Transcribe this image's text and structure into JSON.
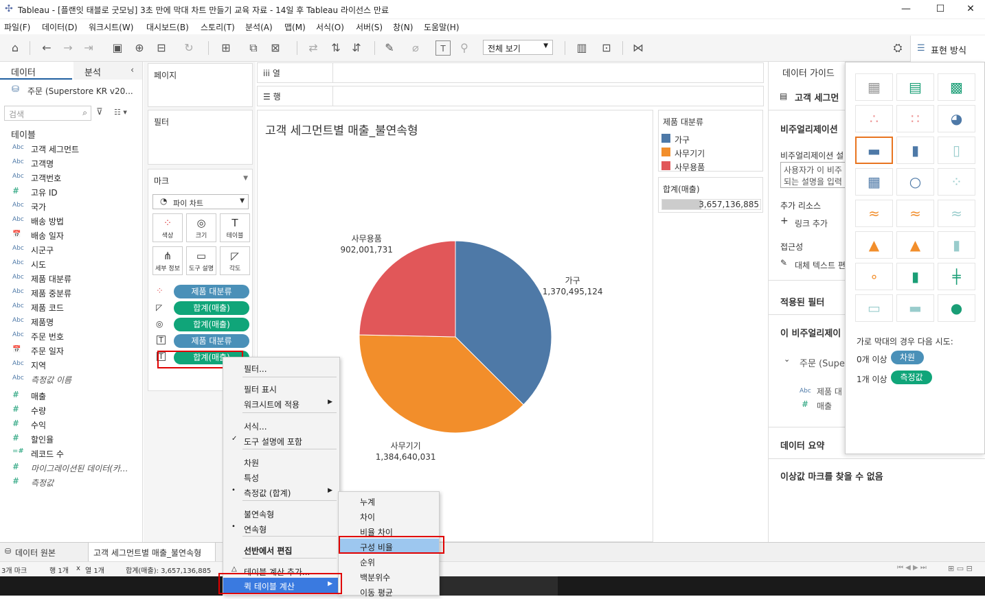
{
  "window": {
    "title": "Tableau - [플랜잇 태블로 굿모닝] 3초 만에 막대 차트 만들기 교육 자료 - 14일 후 Tableau 라이선스 만료"
  },
  "menu": [
    "파일(F)",
    "데이터(D)",
    "워크시트(W)",
    "대시보드(B)",
    "스토리(T)",
    "분석(A)",
    "맵(M)",
    "서식(O)",
    "서버(S)",
    "창(N)",
    "도움말(H)"
  ],
  "toolbar": {
    "view_select": "전체 보기",
    "show_me_label": "표현 방식"
  },
  "left_pane": {
    "tab_data": "데이터",
    "tab_analysis": "분석",
    "datasource": "주문 (Superstore KR v20...",
    "search_placeholder": "검색",
    "tables_header": "테이블",
    "fields": [
      {
        "type": "Abc",
        "name": "고객 세그먼트"
      },
      {
        "type": "Abc",
        "name": "고객명"
      },
      {
        "type": "Abc",
        "name": "고객번호"
      },
      {
        "type": "#",
        "name": "고유 ID"
      },
      {
        "type": "Abc",
        "name": "국가"
      },
      {
        "type": "Abc",
        "name": "배송 방법"
      },
      {
        "type": "date",
        "name": "배송 일자"
      },
      {
        "type": "Abc",
        "name": "시군구"
      },
      {
        "type": "Abc",
        "name": "시도"
      },
      {
        "type": "Abc",
        "name": "제품 대분류"
      },
      {
        "type": "Abc",
        "name": "제품 중분류"
      },
      {
        "type": "Abc",
        "name": "제품 코드"
      },
      {
        "type": "Abc",
        "name": "제품명"
      },
      {
        "type": "Abc",
        "name": "주문 번호"
      },
      {
        "type": "date",
        "name": "주문 일자"
      },
      {
        "type": "Abc",
        "name": "지역"
      },
      {
        "type": "Abc",
        "name": "측정값 이름"
      }
    ],
    "measures": [
      {
        "type": "#",
        "name": "매출"
      },
      {
        "type": "#",
        "name": "수량"
      },
      {
        "type": "#",
        "name": "수익"
      },
      {
        "type": "#",
        "name": "할인율"
      },
      {
        "type": "=#",
        "name": "레코드 수"
      },
      {
        "type": "#",
        "name": "마이그레이션된 데이터(카..."
      },
      {
        "type": "#",
        "name": "측정값"
      }
    ]
  },
  "shelves": {
    "pages": "페이지",
    "filters": "필터",
    "marks": "마크",
    "mark_type": "파이 차트",
    "mark_buttons": [
      "색상",
      "크기",
      "테이블",
      "세부 정보",
      "도구 설명",
      "각도"
    ],
    "mark_pills": [
      "제품 대분류",
      "합계(매출)",
      "합계(매출)",
      "제품 대분류",
      "합계(매출)"
    ],
    "columns": "열",
    "rows": "행"
  },
  "viz": {
    "title": "고객 세그먼트별 매출_불연속형"
  },
  "chart_data": {
    "type": "pie",
    "title": "고객 세그먼트별 매출_불연속형",
    "categories": [
      "가구",
      "사무기기",
      "사무용품"
    ],
    "values": [
      1370495124,
      1384640031,
      902001731
    ],
    "labels": [
      "1,370,495,124",
      "1,384,640,031",
      "902,001,731"
    ],
    "colors": [
      "#4e79a7",
      "#f28e2b",
      "#e15759"
    ]
  },
  "legend": {
    "title": "제품 대분류",
    "items": [
      "가구",
      "사무기기",
      "사무용품"
    ]
  },
  "sum_card": {
    "title": "합계(매출)",
    "value": "3,657,136,885",
    "fill_fraction": 0.5
  },
  "context_menu": {
    "items": [
      "필터...",
      "필터 표시",
      "워크시트에 적용",
      "서식...",
      "도구 설명에 포함",
      "차원",
      "특성",
      "측정값 (합계)",
      "불연속형",
      "연속형",
      "선반에서 편집",
      "테이블 계산 추가...",
      "퀵 테이블 계산"
    ],
    "submenu": [
      "누계",
      "차이",
      "비율 차이",
      "구성 비율",
      "순위",
      "백분위수",
      "이동 평균"
    ]
  },
  "guide": {
    "title": "데이터 가이드",
    "segment": "고객 세그먼",
    "viz_desc_header": "비주얼리제이션",
    "viz_desc_label": "비주얼리제이션 설",
    "viz_desc_text1": "사용자가 이 비주",
    "viz_desc_text2": "되는 설명을 입력",
    "extra_resources": "추가 리소스",
    "add_link": "링크 추가",
    "accessibility": "접근성",
    "alt_text": "대체 텍스트 편",
    "applied_filters": "적용된 필터",
    "this_viz": "이 비주얼리제이",
    "order_source": "주문 (Supe",
    "field1": "제품 대",
    "field2": "매출",
    "data_summary": "데이터 요약",
    "no_outliers": "이상값 마크를 찾을 수 없음"
  },
  "showme": {
    "hint": "가로 막대의 경우 다음 시도:",
    "dim_count": "0개 이상",
    "dim_label": "차원",
    "mea_count": "1개 이상",
    "mea_label": "측정값"
  },
  "bottom": {
    "datasource_tab": "데이터 원본",
    "sheet_tab": "고객 세그먼트별 매출_불연속형",
    "status_marks": "3개 마크",
    "status_rows": "행 1개",
    "status_x": "x",
    "status_cols": "열 1개",
    "status_sum": "합계(매출): 3,657,136,885"
  }
}
